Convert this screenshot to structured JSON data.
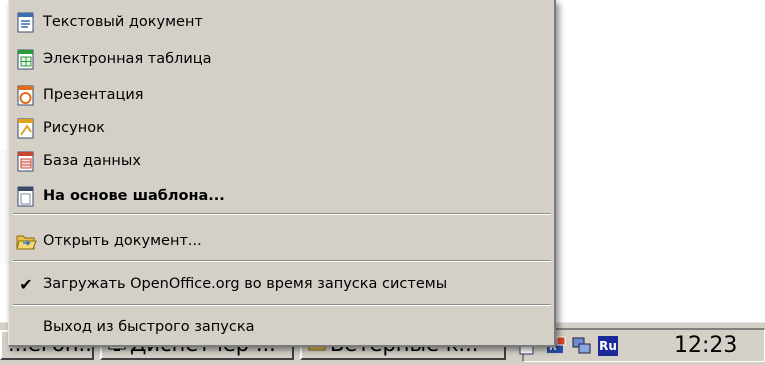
{
  "menu": {
    "items": [
      {
        "label": "Текстовый документ",
        "icon": "writer-icon"
      },
      {
        "label": "Электронная таблица",
        "icon": "calc-icon"
      },
      {
        "label": "Презентация",
        "icon": "impress-icon"
      },
      {
        "label": "Рисунок",
        "icon": "draw-icon"
      },
      {
        "label": "База данных",
        "icon": "base-icon"
      },
      {
        "label": "На основе шаблона...",
        "icon": "template-icon"
      }
    ],
    "open_document": "Открыть документ...",
    "load_on_startup": "Загружать OpenOffice.org во время запуска системы",
    "load_on_startup_checked": true,
    "exit_quickstart": "Выход из быстрого запуска"
  },
  "taskbar": {
    "buttons": [
      {
        "label": "...егоп...",
        "icon": "window-icon"
      },
      {
        "label": "Диспетчер ...",
        "icon": "task-manager-icon"
      },
      {
        "label": "Ветерные к...",
        "icon": "folder-icon"
      }
    ],
    "tray": {
      "language": "Ru",
      "clock": "12:23",
      "icons": [
        "quickstart-icon",
        "network-icon"
      ]
    }
  },
  "colors": {
    "menu_bg": "#d4d0c8",
    "writer": "#3a6fb5",
    "calc": "#2e9a3a",
    "impress": "#e06d1c",
    "draw": "#e0a21c",
    "base": "#c9452f",
    "lang_bg": "#1a2a9c"
  }
}
